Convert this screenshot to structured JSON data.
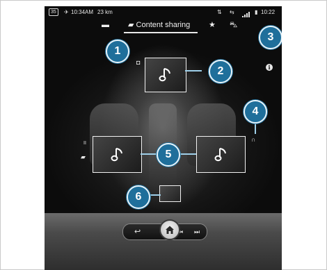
{
  "status_bar": {
    "badge": "35",
    "time_left": "10:34AM",
    "distance": "23 km",
    "time_right": "10:22"
  },
  "tabs": {
    "active_label": "Content sharing",
    "items": [
      "messages-icon",
      "content-sharing-icon",
      "star-icon",
      "car-icon"
    ]
  },
  "callouts": [
    "1",
    "2",
    "3",
    "4",
    "5",
    "6"
  ],
  "side_icons": {
    "pause": "II"
  },
  "info_symbol": "i",
  "colors": {
    "callout_fill": "#1f6f9b",
    "callout_ring": "#e8f3f9",
    "leader_line": "#9fd0ea"
  }
}
